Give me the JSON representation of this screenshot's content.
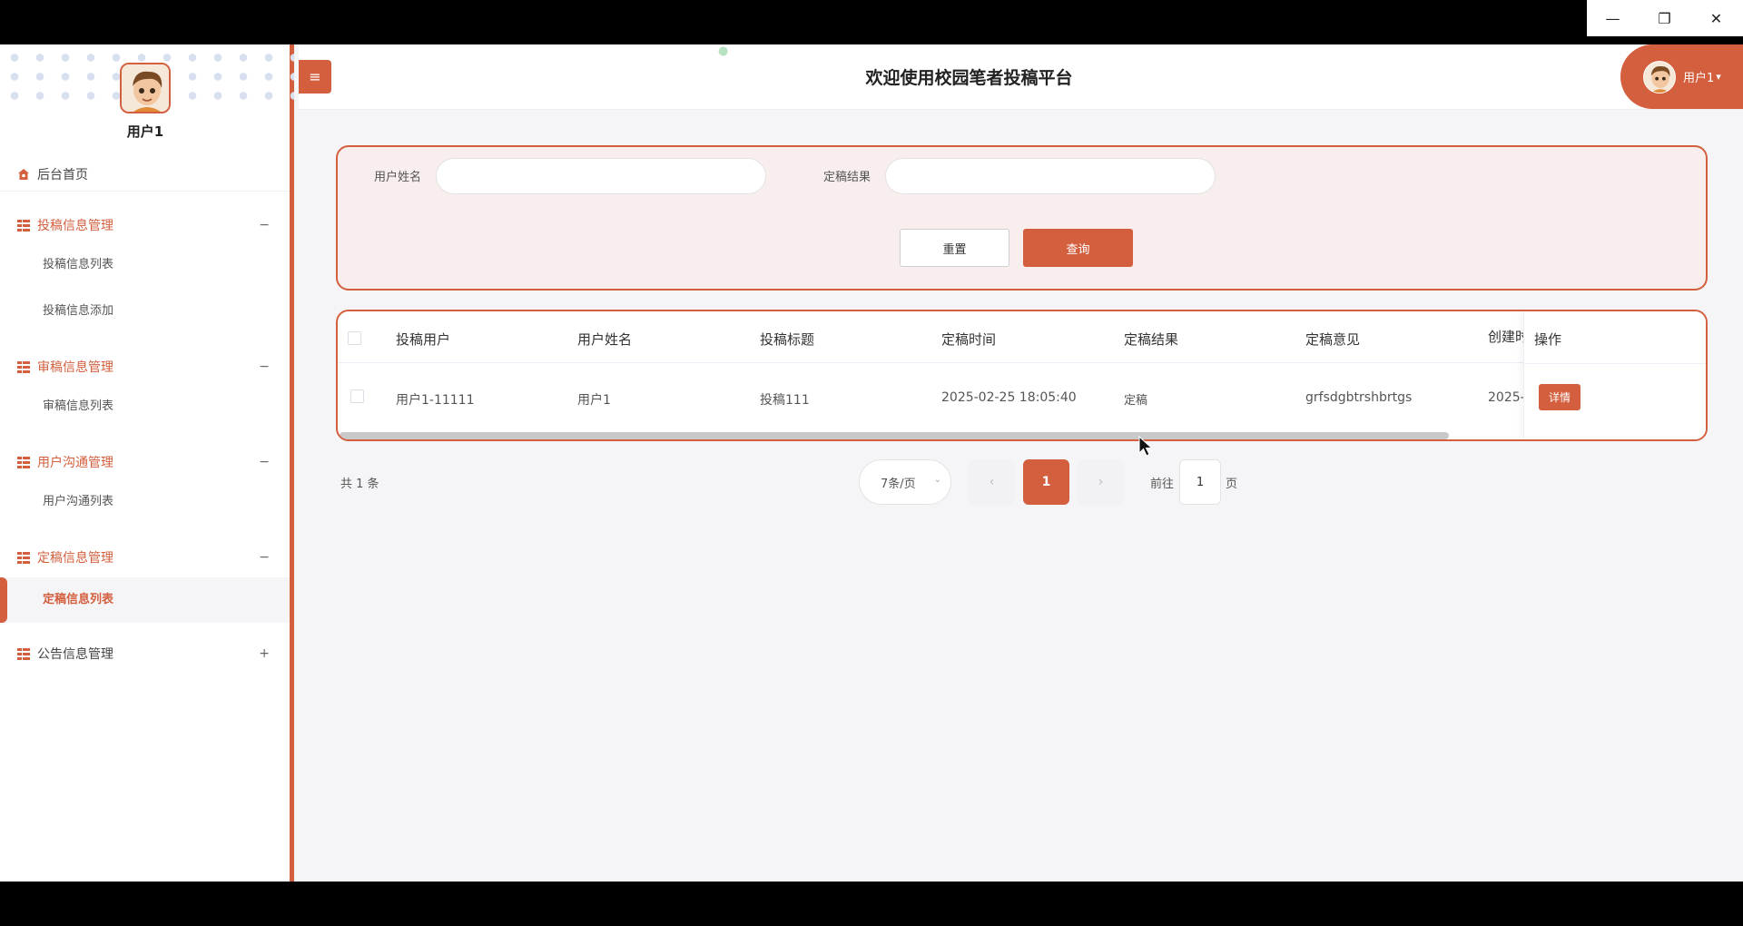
{
  "window": {
    "minimize": "—",
    "restore": "❐",
    "close": "✕"
  },
  "header": {
    "title": "欢迎使用校园笔者投稿平台",
    "menu_toggle": "≡",
    "user_label": "用户1",
    "user_caret": "▾"
  },
  "sidebar": {
    "username": "用户1",
    "home": "后台首页",
    "groups": [
      {
        "label": "投稿信息管理",
        "toggle": "−",
        "items": [
          "投稿信息列表",
          "投稿信息添加"
        ]
      },
      {
        "label": "审稿信息管理",
        "toggle": "−",
        "items": [
          "审稿信息列表"
        ]
      },
      {
        "label": "用户沟通管理",
        "toggle": "−",
        "items": [
          "用户沟通列表"
        ]
      },
      {
        "label": "定稿信息管理",
        "toggle": "−",
        "items": [
          "定稿信息列表"
        ]
      },
      {
        "label": "公告信息管理",
        "toggle": "+",
        "items": []
      }
    ],
    "active_item": "定稿信息列表"
  },
  "search": {
    "fields": [
      {
        "label": "用户姓名",
        "value": ""
      },
      {
        "label": "定稿结果",
        "value": ""
      }
    ],
    "reset_label": "重置",
    "query_label": "查询"
  },
  "table": {
    "columns": [
      "投稿用户",
      "用户姓名",
      "投稿标题",
      "定稿时间",
      "定稿结果",
      "定稿意见",
      "创建时",
      "操作"
    ],
    "rows": [
      {
        "submit_user": "用户1-11111",
        "user_name": "用户1",
        "title": "投稿111",
        "final_time": "2025-02-25 18:05:40",
        "result": "定稿",
        "opinion": "grfsdgbtrshbrtgs",
        "created": "2025-",
        "action": "详情"
      }
    ]
  },
  "pagination": {
    "total": "共 1 条",
    "page_size": "7条/页",
    "prev": "‹",
    "current": "1",
    "next": "›",
    "goto_label": "前往",
    "goto_value": "1",
    "goto_suffix": "页"
  },
  "colors": {
    "accent": "#d35f3f",
    "panel_bg": "#f7eeed",
    "page_bg": "#f5f5f7"
  }
}
